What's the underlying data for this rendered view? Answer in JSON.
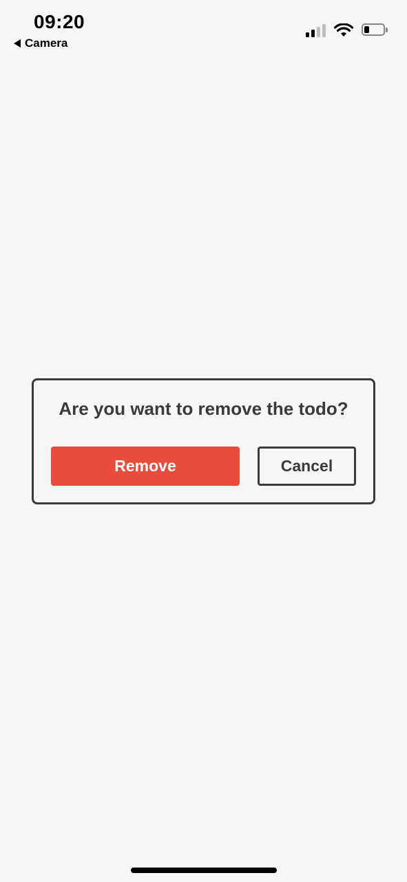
{
  "status_bar": {
    "time": "09:20",
    "back_label": "Camera",
    "battery_level": 0.25,
    "signal_bars_active": 2,
    "signal_bars_total": 4
  },
  "dialog": {
    "message": "Are you want to remove the todo?",
    "remove_label": "Remove",
    "cancel_label": "Cancel"
  },
  "colors": {
    "background": "#f6f6f6",
    "remove_button": "#e84c3d",
    "border": "#3a3a3a",
    "text": "#3a3a3a"
  },
  "icons": {
    "back": "back-arrow-icon",
    "signal": "cellular-signal-icon",
    "wifi": "wifi-icon",
    "battery": "battery-icon"
  }
}
